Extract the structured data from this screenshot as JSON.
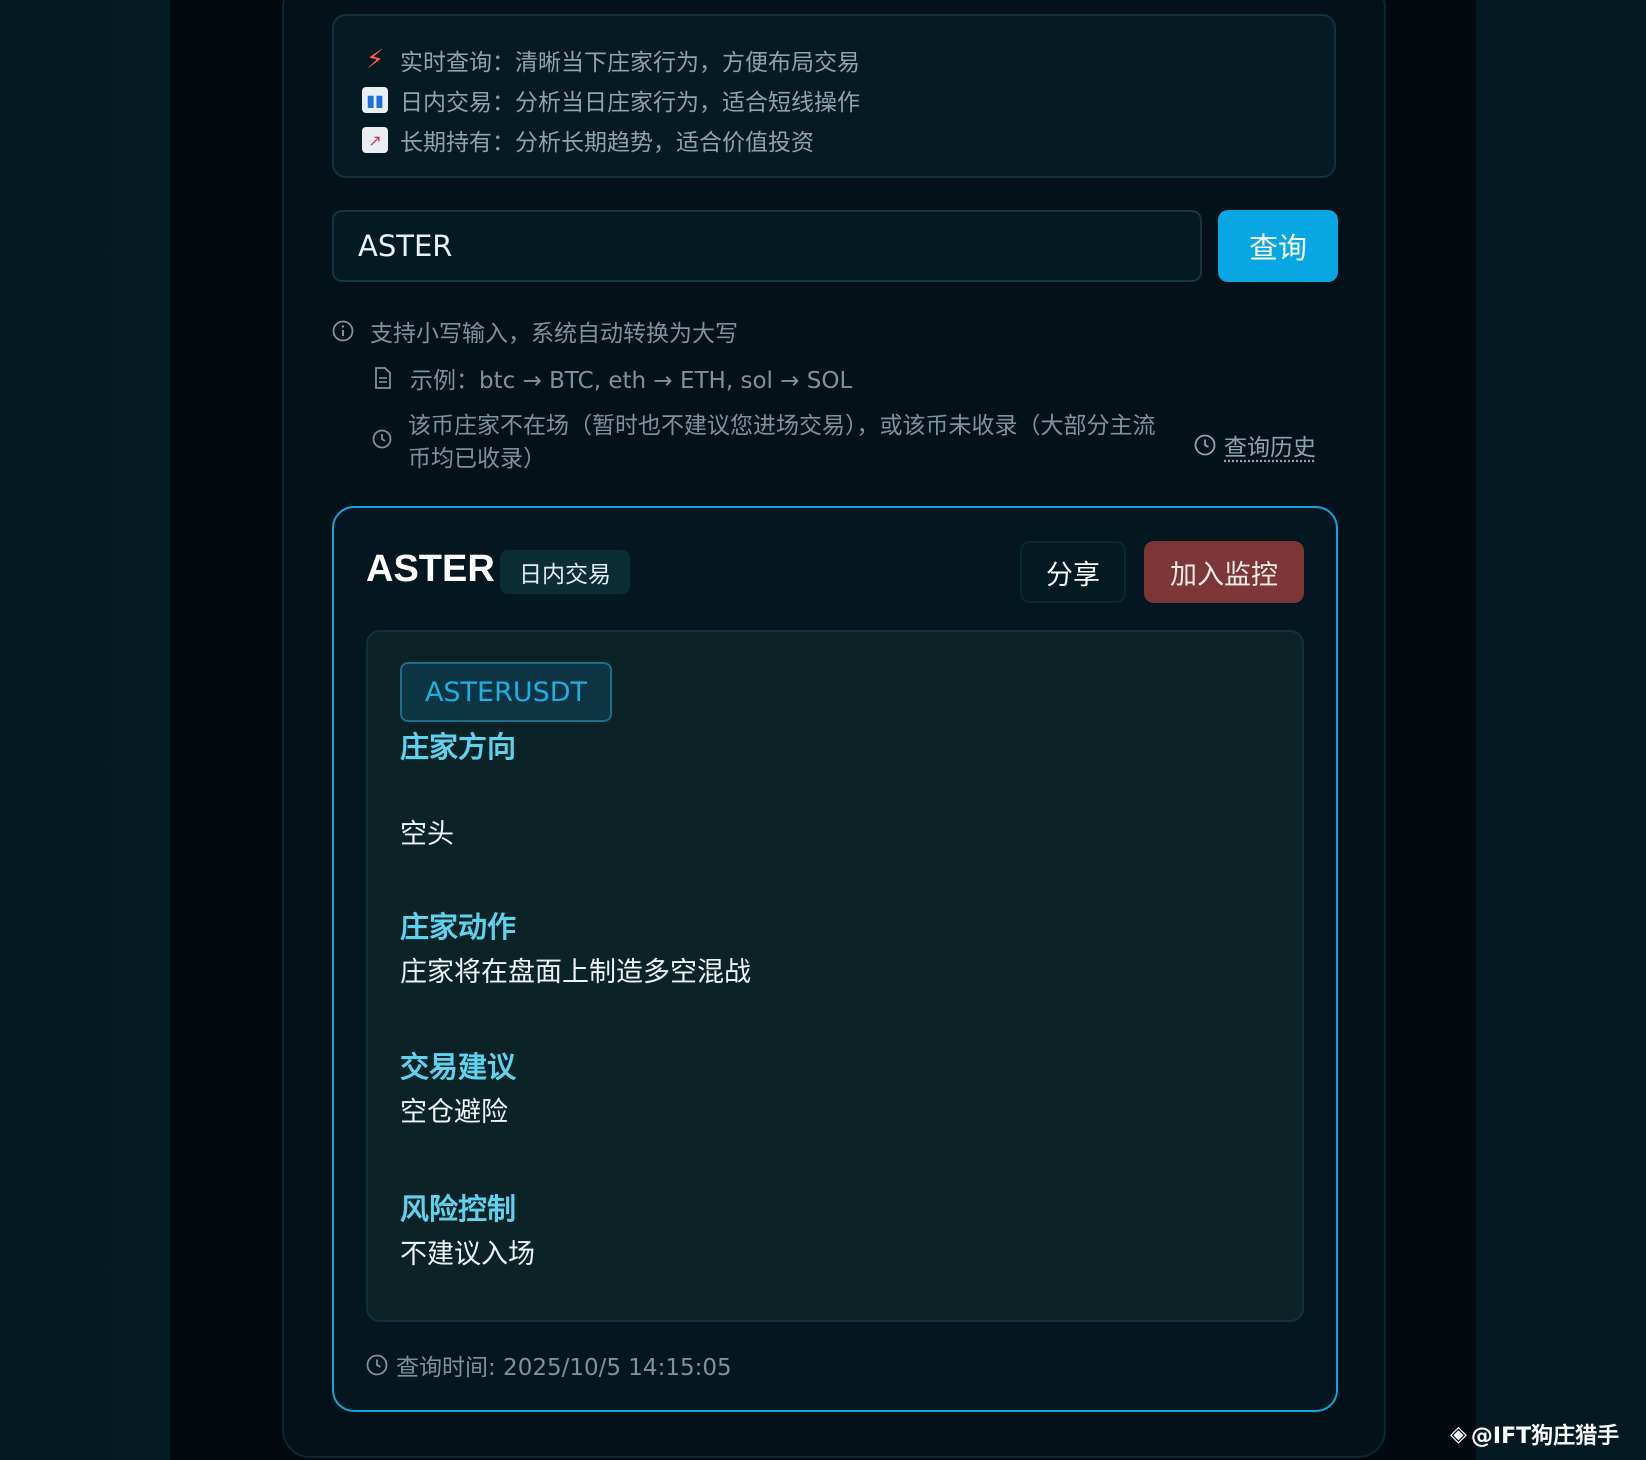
{
  "tips": [
    {
      "icon": "lightning-icon",
      "text": "实时查询：清晰当下庄家行为，方便布局交易"
    },
    {
      "icon": "bar-chart-icon",
      "text": "日内交易：分析当日庄家行为，适合短线操作"
    },
    {
      "icon": "trend-chart-icon",
      "text": "长期持有：分析长期趋势，适合价值投资"
    }
  ],
  "search": {
    "value": "ASTER",
    "button_label": "查询"
  },
  "hints": {
    "uppercase": "支持小写输入，系统自动转换为大写",
    "example": "示例：btc → BTC, eth → ETH, sol → SOL",
    "not_listed": "该币庄家不在场（暂时也不建议您进场交易），或该币未收录（大部分主流币均已收录）",
    "history_link": "查询历史"
  },
  "result": {
    "symbol": "ASTER",
    "mode": "日内交易",
    "share_label": "分享",
    "monitor_label": "加入监控",
    "pair": "ASTERUSDT",
    "sections": [
      {
        "label": "庄家方向",
        "value": "空头"
      },
      {
        "label": "庄家动作",
        "value": "庄家将在盘面上制造多空混战"
      },
      {
        "label": "交易建议",
        "value": "空仓避险"
      },
      {
        "label": "风险控制",
        "value": "不建议入场"
      }
    ],
    "query_time": "查询时间: 2025/10/5 14:15:05"
  },
  "watermark": "@IFT狗庄猎手",
  "colors": {
    "accent": "#07a7e3",
    "monitor": "#7d3638",
    "section_label": "#5fd2ee"
  }
}
